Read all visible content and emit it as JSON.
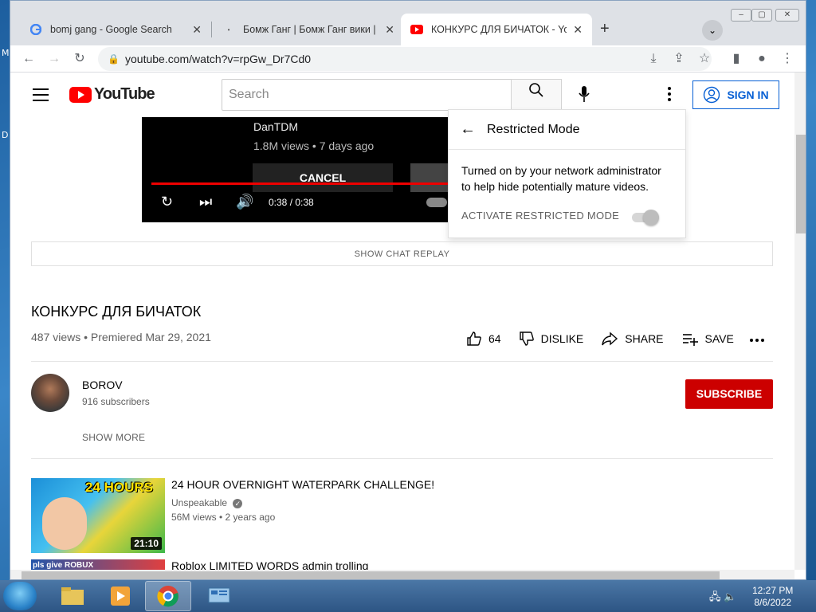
{
  "desktop": {
    "side_letters": [
      "M",
      "D"
    ]
  },
  "tabs": [
    {
      "title": "bomj gang - Google Search",
      "icon": "google-icon"
    },
    {
      "title": "Бомж Ганг | Бомж Ганг вики | Fandom",
      "icon": "fandom-icon"
    },
    {
      "title": "КОНКУРС ДЛЯ БИЧАТОК - YouTube",
      "icon": "youtube-icon"
    }
  ],
  "address_bar": {
    "url": "youtube.com/watch?v=rpGw_Dr7Cd0"
  },
  "youtube": {
    "logo_text": "YouTube",
    "search_placeholder": "Search",
    "sign_in": "SIGN IN"
  },
  "player": {
    "creator": "DanTDM",
    "meta": "1.8M views • 7 days ago",
    "cancel_label": "CANCEL",
    "time": "0:38 / 0:38"
  },
  "restricted_mode": {
    "title": "Restricted Mode",
    "description": "Turned on by your network administrator to help hide potentially mature videos.",
    "activate_label": "ACTIVATE RESTRICTED MODE"
  },
  "chat_replay": "SHOW CHAT REPLAY",
  "video": {
    "title": "КОНКУРС ДЛЯ БИЧАТОК",
    "info": "487 views • Premiered Mar 29, 2021",
    "likes": "64",
    "dislike": "DISLIKE",
    "share": "SHARE",
    "save": "SAVE"
  },
  "channel": {
    "name": "BOROV",
    "subscribers": "916 subscribers",
    "subscribe": "SUBSCRIBE",
    "show_more": "SHOW MORE"
  },
  "recommendations": [
    {
      "title": "24 HOUR OVERNIGHT WATERPARK CHALLENGE!",
      "channel": "Unspeakable",
      "meta": "56M views • 2 years ago",
      "duration": "21:10",
      "thumb_text": "24 HOURS"
    },
    {
      "title": "Roblox LIMITED WORDS admin trolling",
      "thumb_text": "pls give ROBUX"
    }
  ],
  "taskbar": {
    "time": "12:27 PM",
    "date": "8/6/2022"
  },
  "colors": {
    "youtube_red": "#ff0000",
    "subscribe_red": "#cc0000",
    "signin_blue": "#065fd4"
  }
}
